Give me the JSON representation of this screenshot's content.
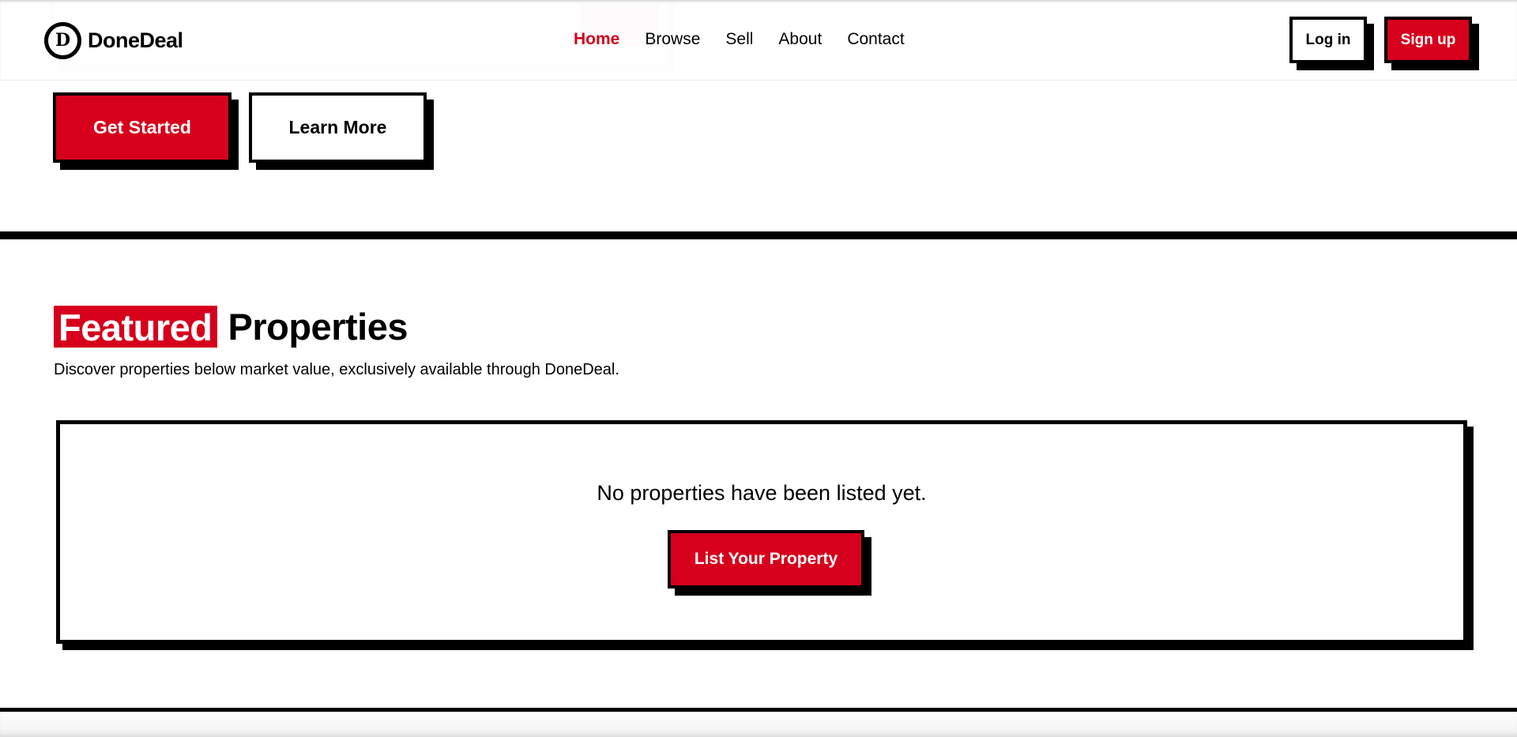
{
  "brand": {
    "logo_letter": "D",
    "name": "DoneDeal"
  },
  "nav": {
    "items": [
      {
        "label": "Home",
        "active": true
      },
      {
        "label": "Browse",
        "active": false
      },
      {
        "label": "Sell",
        "active": false
      },
      {
        "label": "About",
        "active": false
      },
      {
        "label": "Contact",
        "active": false
      }
    ]
  },
  "auth": {
    "login_label": "Log in",
    "signup_label": "Sign up"
  },
  "hero": {
    "primary_cta": "Get Started",
    "secondary_cta": "Learn More"
  },
  "featured": {
    "title_highlight": "Featured",
    "title_rest": "Properties",
    "subtitle": "Discover properties below market value, exclusively available through DoneDeal.",
    "empty_message": "No properties have been listed yet.",
    "empty_cta": "List Your Property"
  },
  "colors": {
    "accent": "#d6001c",
    "ink": "#000000",
    "background": "#ffffff"
  }
}
